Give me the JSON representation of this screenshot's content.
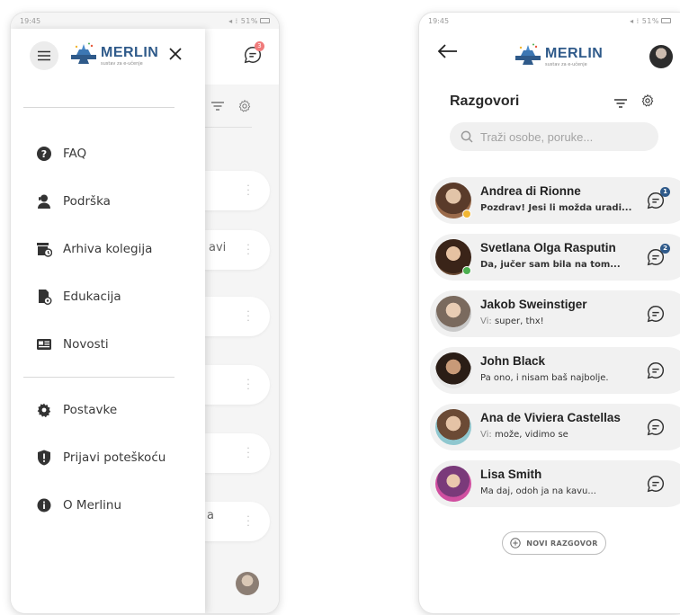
{
  "left_screen": {
    "status": {
      "time": "19:45",
      "indicators": "51%"
    },
    "background": {
      "chat_badge": "3",
      "partial_text_1": "avi",
      "partial_text_2": "a"
    },
    "drawer": {
      "logo": {
        "name": "MERLIN",
        "subtitle": "sustav za e-učenje"
      },
      "menu_group_1": [
        {
          "label": "FAQ",
          "icon": "question-icon"
        },
        {
          "label": "Podrška",
          "icon": "support-icon"
        },
        {
          "label": "Arhiva kolegija",
          "icon": "archive-icon"
        },
        {
          "label": "Edukacija",
          "icon": "education-icon"
        },
        {
          "label": "Novosti",
          "icon": "news-icon"
        }
      ],
      "menu_group_2": [
        {
          "label": "Postavke",
          "icon": "gear-icon"
        },
        {
          "label": "Prijavi poteškoću",
          "icon": "shield-alert-icon"
        },
        {
          "label": "O Merlinu",
          "icon": "info-icon"
        }
      ]
    }
  },
  "right_screen": {
    "status": {
      "time": "19:45",
      "indicators": "51%"
    },
    "header": {
      "logo_name": "MERLIN",
      "logo_subtitle": "sustav za e-učenje"
    },
    "title": "Razgovori",
    "search": {
      "placeholder": "Traži osobe, poruke..."
    },
    "conversations": [
      {
        "name": "Andrea di Rionne",
        "preview": "Pozdrav! Jesi li možda uradi...",
        "unread": "1",
        "status_color": "#f2b632",
        "preview_bold": true
      },
      {
        "name": "Svetlana Olga Rasputin",
        "preview": "Da, jučer sam bila na tom...",
        "unread": "2",
        "status_color": "#4caf50",
        "preview_bold": true
      },
      {
        "name": "Jakob Sweinstiger",
        "prefix": "Vi:",
        "preview": "super, thx!",
        "unread": "",
        "status_color": "",
        "preview_bold": false
      },
      {
        "name": "John Black",
        "preview": "Pa ono, i nisam baš najbolje.",
        "unread": "",
        "status_color": "",
        "preview_bold": false
      },
      {
        "name": "Ana de Viviera Castellas",
        "prefix": "Vi:",
        "preview": "može, vidimo se",
        "unread": "",
        "status_color": "",
        "preview_bold": false
      },
      {
        "name": "Lisa Smith",
        "preview": "Ma daj, odoh ja na kavu...",
        "unread": "",
        "status_color": "",
        "preview_bold": false
      }
    ],
    "new_conversation_label": "NOVI RAZGOVOR"
  },
  "colors": {
    "brand_blue": "#2f5a8a",
    "badge_red": "#f07b7b",
    "online_green": "#4caf50",
    "away_yellow": "#f2b632"
  }
}
